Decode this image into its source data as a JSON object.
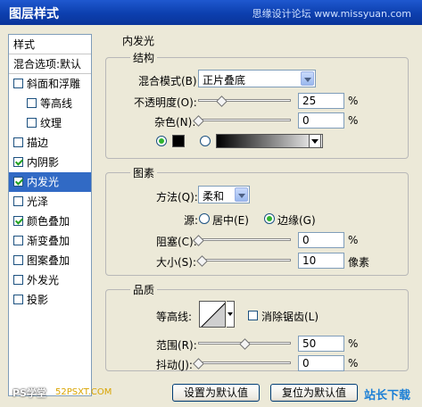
{
  "window": {
    "title": "图层样式",
    "watermark": "思缘设计论坛 www.missyuan.com"
  },
  "sidebar": {
    "head": "样式",
    "blend_default": "混合选项:默认",
    "items": [
      {
        "label": "斜面和浮雕",
        "checked": false,
        "indent": false
      },
      {
        "label": "等高线",
        "checked": false,
        "indent": true
      },
      {
        "label": "纹理",
        "checked": false,
        "indent": true
      },
      {
        "label": "描边",
        "checked": false,
        "indent": false
      },
      {
        "label": "内阴影",
        "checked": true,
        "indent": false
      },
      {
        "label": "内发光",
        "checked": true,
        "indent": false,
        "active": true
      },
      {
        "label": "光泽",
        "checked": false,
        "indent": false
      },
      {
        "label": "颜色叠加",
        "checked": true,
        "indent": false
      },
      {
        "label": "渐变叠加",
        "checked": false,
        "indent": false
      },
      {
        "label": "图案叠加",
        "checked": false,
        "indent": false
      },
      {
        "label": "外发光",
        "checked": false,
        "indent": false
      },
      {
        "label": "投影",
        "checked": false,
        "indent": false
      }
    ]
  },
  "panel": {
    "title": "内发光",
    "structure": {
      "label": "结构",
      "blend_mode_label": "混合模式(B):",
      "blend_mode_value": "正片叠底",
      "opacity_label": "不透明度(O):",
      "opacity_value": "25",
      "opacity_pct": 25,
      "noise_label": "杂色(N):",
      "noise_value": "0",
      "noise_pct": 0,
      "unit": "%",
      "color_selected": "solid",
      "glow_color": "#000000"
    },
    "elements": {
      "label": "图素",
      "technique_label": "方法(Q):",
      "technique_value": "柔和",
      "source_label": "源:",
      "source_center": "居中(E)",
      "source_edge": "边缘(G)",
      "source_selected": "edge",
      "choke_label": "阻塞(C):",
      "choke_value": "0",
      "choke_pct": 0,
      "size_label": "大小(S):",
      "size_value": "10",
      "size_fraction": 0.04,
      "unit_pct": "%",
      "unit_px": "像素"
    },
    "quality": {
      "label": "品质",
      "contour_label": "等高线:",
      "antialias_label": "消除锯齿(L)",
      "antialias_checked": false,
      "range_label": "范围(R):",
      "range_value": "50",
      "range_pct": 50,
      "jitter_label": "抖动(J):",
      "jitter_value": "0",
      "jitter_pct": 0,
      "unit": "%"
    },
    "buttons": {
      "set_default": "设置为默认值",
      "reset_default": "复位为默认值"
    }
  },
  "footer": {
    "ps_logo": "PS学堂",
    "site": "52PSXT.COM",
    "station": "站长下载"
  },
  "colors": {
    "accent": "#316ac5",
    "titlebar": "#0c3fae",
    "check": "#21a121"
  }
}
